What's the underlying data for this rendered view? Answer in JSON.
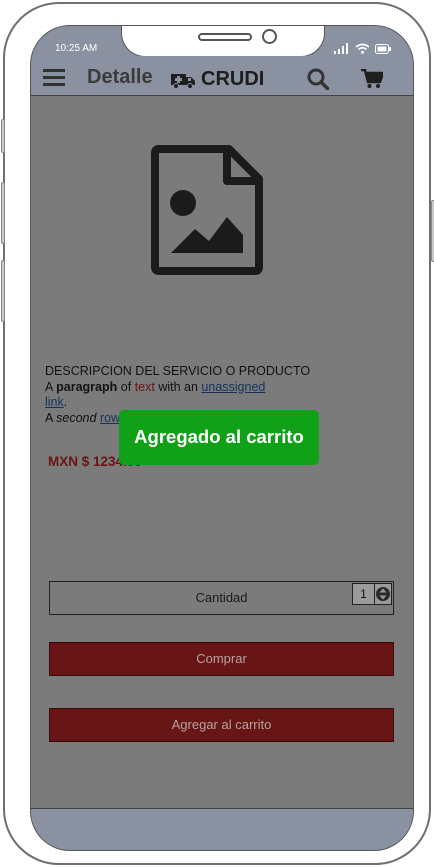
{
  "status_bar": {
    "time": "10:25 AM"
  },
  "app_bar": {
    "title": "Detalle",
    "brand": "CRUDI",
    "icons": [
      "menu-icon",
      "ambulance-icon",
      "search-icon",
      "cart-icon"
    ]
  },
  "product": {
    "image_icon": "image-file-icon",
    "description_title": "DESCRIPCION DEL SERVICIO O PRODUCTO",
    "para_a": "A",
    "para_bold": "paragraph",
    "para_of": "of",
    "para_text": "text",
    "para_with": "with an",
    "para_link": "unassigned",
    "para_link2": "link",
    "para_dot": ".",
    "second_a": "A",
    "second_italic": "second",
    "second_row": "row",
    "price": "MXN $ 1234.00"
  },
  "quantity": {
    "label": "Cantidad",
    "value": "1"
  },
  "actions": {
    "buy_label": "Comprar",
    "add_label": "Agregar al carrito"
  },
  "toast": {
    "message": "Agregado al carrito"
  },
  "colors": {
    "bar": "#8a91a1",
    "button": "#671515",
    "toast": "#11a118",
    "price": "#6a1414"
  }
}
